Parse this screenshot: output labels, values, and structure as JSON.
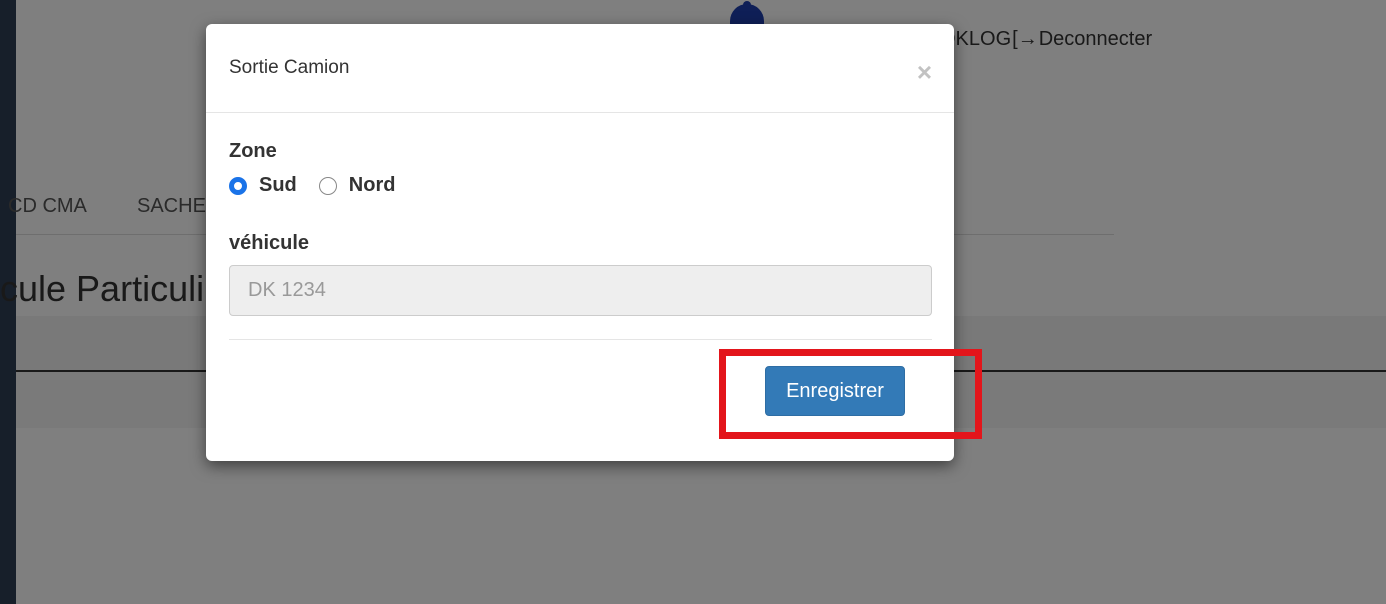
{
  "header": {
    "user_fragment": "OKLOG",
    "logout_icon": "logout-icon",
    "logout_label": "Deconnecter"
  },
  "nav": {
    "tabs": [
      "CD CMA",
      "SACHE"
    ]
  },
  "page": {
    "title_fragment": "cule Particuli"
  },
  "modal": {
    "title": "Sortie Camion",
    "close_symbol": "×",
    "zone": {
      "label": "Zone",
      "options": [
        {
          "label": "Sud",
          "checked": true
        },
        {
          "label": "Nord",
          "checked": false
        }
      ]
    },
    "vehicle": {
      "label": "véhicule",
      "placeholder": "DK 1234",
      "value": ""
    },
    "save_label": "Enregistrer"
  },
  "colors": {
    "primary_button": "#337ab7",
    "radio_checked": "#1a73e8",
    "annotation_box": "#e3151b"
  }
}
